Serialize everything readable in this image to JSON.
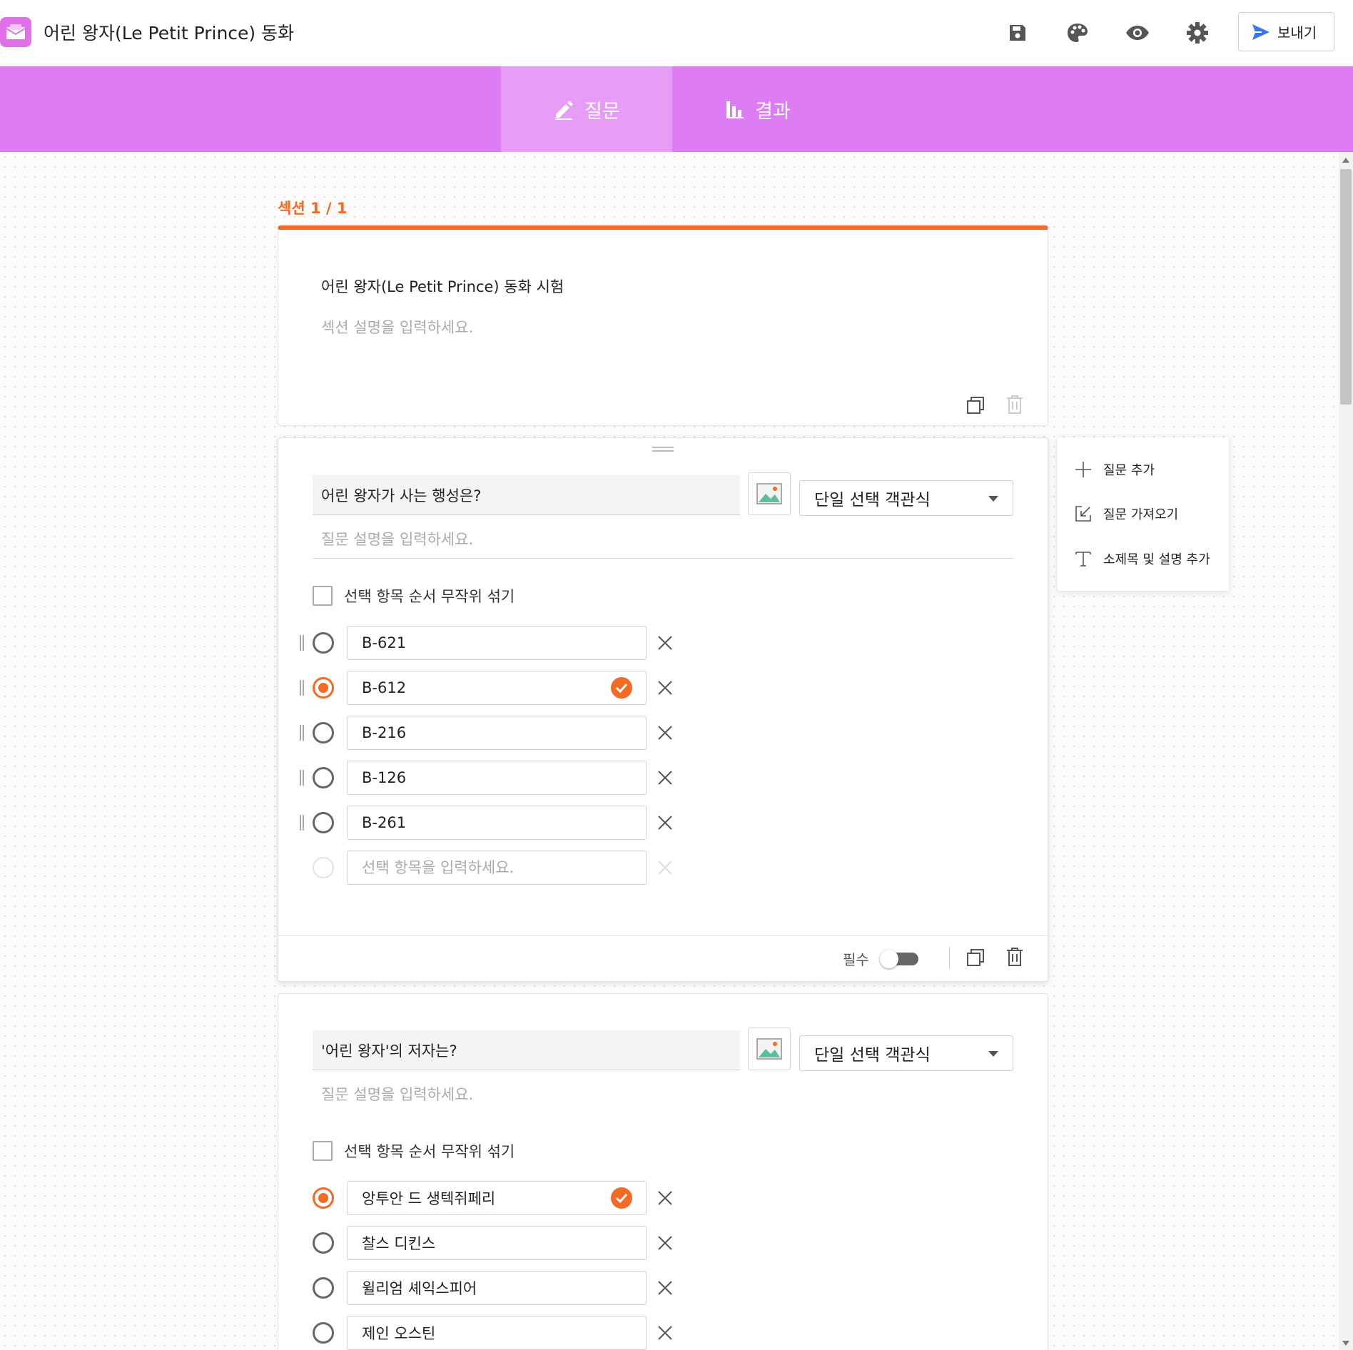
{
  "app": {
    "title": "어린 왕자(Le Petit Prince) 동화",
    "icons": [
      "mail-logo-icon",
      "save-icon",
      "palette-icon",
      "eye-icon",
      "gear-icon",
      "send-icon"
    ],
    "send_label": "보내기",
    "accent_color": "#f26a24",
    "brand_color": "#de7cf4"
  },
  "tabs": [
    {
      "label": "질문",
      "icon": "pencil-icon",
      "active": true
    },
    {
      "label": "결과",
      "icon": "bar-chart-icon",
      "active": false
    }
  ],
  "section": {
    "label": "섹션 1 / 1",
    "title": "어린 왕자(Le Petit Prince) 동화 시험",
    "description_placeholder": "섹션 설명을 입력하세요."
  },
  "questions": [
    {
      "title": "어린 왕자가 사는 행성은?",
      "type": "단일 선택 객관식",
      "description_placeholder": "질문 설명을 입력하세요.",
      "shuffle_label": "선택 항목 순서 무작위 섞기",
      "options": [
        "B-621",
        "B-612",
        "B-216",
        "B-126",
        "B-261"
      ],
      "correct_index": 1,
      "new_option_placeholder": "선택 항목을 입력하세요.",
      "required_label": "필수",
      "required": false
    },
    {
      "title": "'어린 왕자'의 저자는?",
      "type": "단일 선택 객관식",
      "description_placeholder": "질문 설명을 입력하세요.",
      "shuffle_label": "선택 항목 순서 무작위 섞기",
      "options": [
        "앙투안 드 생텍쥐페리",
        "찰스 디킨스",
        "윌리엄 셰익스피어",
        "제인 오스틴"
      ],
      "correct_index": 0
    }
  ],
  "side_menu": {
    "items": [
      {
        "label": "질문 추가",
        "icon": "plus-icon"
      },
      {
        "label": "질문 가져오기",
        "icon": "import-icon"
      },
      {
        "label": "소제목 및 설명 추가",
        "icon": "text-icon"
      }
    ]
  }
}
